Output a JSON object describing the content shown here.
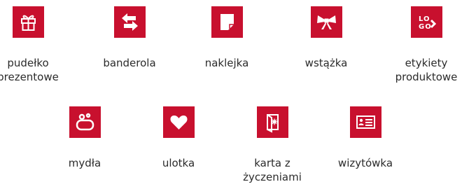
{
  "colors": {
    "tile": "#c8102e",
    "icon": "#ffffff",
    "text": "#2b2b2b"
  },
  "rows": [
    [
      {
        "icon": "gift-icon",
        "label": "pudełko prezentowe"
      },
      {
        "icon": "band-arrows-icon",
        "label": "banderola"
      },
      {
        "icon": "sticker-icon",
        "label": "naklejka"
      },
      {
        "icon": "bow-icon",
        "label": "wstążka"
      },
      {
        "icon": "logo-icon",
        "label": "etykiety produktowe",
        "icon_text": [
          "LO",
          "GO"
        ]
      }
    ],
    [
      {
        "icon": "soap-icon",
        "label": "mydła"
      },
      {
        "icon": "heart-icon",
        "label": "ulotka"
      },
      {
        "icon": "greeting-card-icon",
        "label": "karta z życzeniami"
      },
      {
        "icon": "business-card-icon",
        "label": "wizytówka"
      }
    ]
  ]
}
